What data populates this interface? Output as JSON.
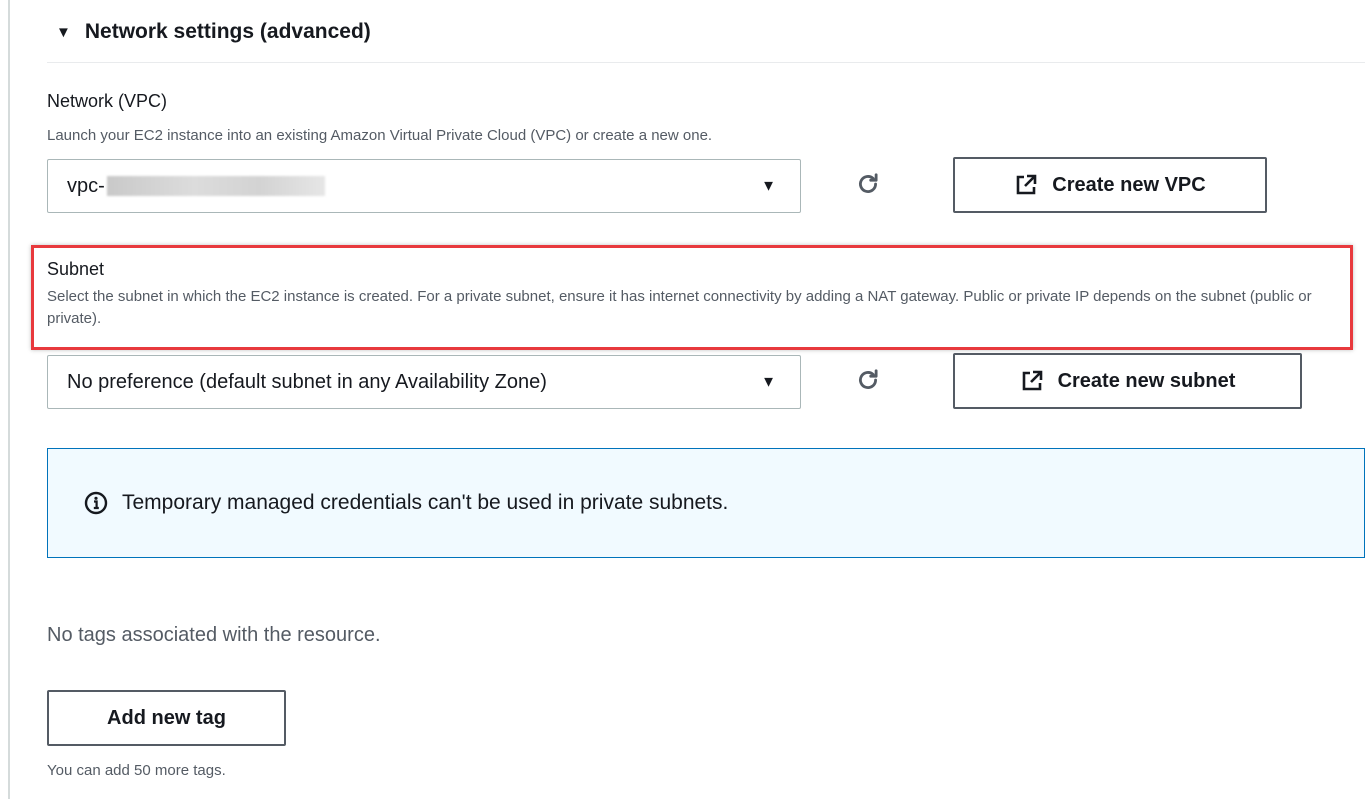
{
  "section": {
    "title": "Network settings (advanced)",
    "expanded": true
  },
  "vpc": {
    "label": "Network (VPC)",
    "description": "Launch your EC2 instance into an existing Amazon Virtual Private Cloud (VPC) or create a new one.",
    "selected_value": "vpc-",
    "create_button_label": "Create new VPC"
  },
  "subnet": {
    "label": "Subnet",
    "description": "Select the subnet in which the EC2 instance is created. For a private subnet, ensure it has internet connectivity by adding a NAT gateway. Public or private IP depends on the subnet (public or private).",
    "selected_value": "No preference (default subnet in any Availability Zone)",
    "create_button_label": "Create new subnet"
  },
  "info_alert": {
    "text": "Temporary managed credentials can't be used in private subnets."
  },
  "tags": {
    "empty_text": "No tags associated with the resource.",
    "add_button_label": "Add new tag",
    "remaining_note": "You can add 50 more tags."
  },
  "colors": {
    "highlight_border": "#e8393d",
    "info_border": "#0073bb",
    "info_background": "#f1faff"
  }
}
